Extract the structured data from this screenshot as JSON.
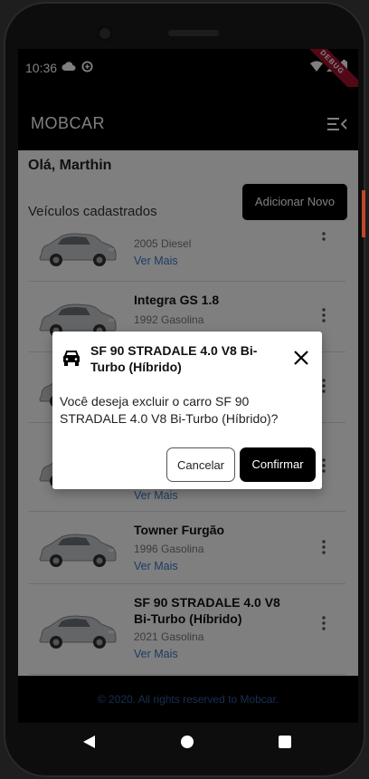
{
  "status_bar": {
    "time": "10:36",
    "debug_label": "DEBUG"
  },
  "app_bar": {
    "title": "MOBCAR"
  },
  "greeting": "Olá, Marthin",
  "section_title": "Veículos cadastrados",
  "add_button": "Adicionar Novo",
  "cars": [
    {
      "name": "",
      "subtitle": "2005 Diesel",
      "link": "Ver Mais"
    },
    {
      "name": "Integra GS 1.8",
      "subtitle": "1992 Gasolina",
      "link": ""
    },
    {
      "name": "",
      "subtitle": "",
      "link": ""
    },
    {
      "name": "",
      "subtitle": "",
      "link": "Ver Mais"
    },
    {
      "name": "Towner Furgão",
      "subtitle": "1996 Gasolina",
      "link": "Ver Mais"
    },
    {
      "name": "SF 90 STRADALE 4.0 V8 Bi-Turbo (Híbrido)",
      "subtitle": "2021 Gasolina",
      "link": "Ver Mais"
    }
  ],
  "footer": "©  2020. All rights reserved to Mobcar.",
  "dialog": {
    "title": "SF 90 STRADALE 4.0 V8 Bi-Turbo (Híbrido)",
    "body": "Você deseja excluir o carro SF 90 STRADALE 4.0 V8 Bi-Turbo (Híbrido)?",
    "cancel": "Cancelar",
    "confirm": "Confirmar"
  },
  "colors": {
    "accent": "#000000",
    "link": "#3a78c9",
    "footer_text": "#2f5da5",
    "debug_ribbon": "#a3102e"
  }
}
